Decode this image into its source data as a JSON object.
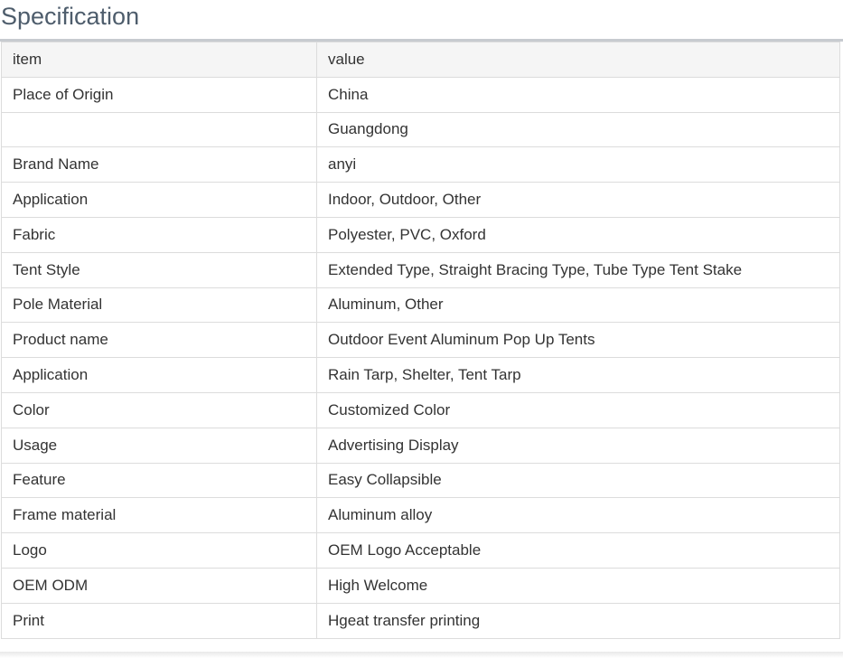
{
  "section": {
    "title": "Specification"
  },
  "table": {
    "header": {
      "item": "item",
      "value": "value"
    },
    "rows": [
      {
        "item": "Place of Origin",
        "value": "China"
      },
      {
        "item": "",
        "value": "Guangdong"
      },
      {
        "item": "Brand Name",
        "value": "anyi"
      },
      {
        "item": "Application",
        "value": "Indoor, Outdoor, Other"
      },
      {
        "item": "Fabric",
        "value": "Polyester, PVC, Oxford"
      },
      {
        "item": "Tent Style",
        "value": "Extended Type, Straight Bracing Type, Tube Type Tent Stake"
      },
      {
        "item": "Pole Material",
        "value": "Aluminum, Other"
      },
      {
        "item": "Product name",
        "value": "Outdoor Event Aluminum Pop Up Tents"
      },
      {
        "item": "Application",
        "value": "Rain Tarp, Shelter, Tent Tarp"
      },
      {
        "item": "Color",
        "value": "Customized Color"
      },
      {
        "item": "Usage",
        "value": "Advertising Display"
      },
      {
        "item": "Feature",
        "value": "Easy Collapsible"
      },
      {
        "item": "Frame material",
        "value": "Aluminum alloy"
      },
      {
        "item": "Logo",
        "value": "OEM Logo Acceptable"
      },
      {
        "item": "OEM ODM",
        "value": "High Welcome"
      },
      {
        "item": "Print",
        "value": "Hgeat transfer printing"
      }
    ]
  },
  "colors": {
    "title": "#4e5d6c",
    "text": "#333333",
    "border": "#dcdcdc",
    "header_bg": "#f5f5f5",
    "title_rule": "#c7cbd0"
  }
}
